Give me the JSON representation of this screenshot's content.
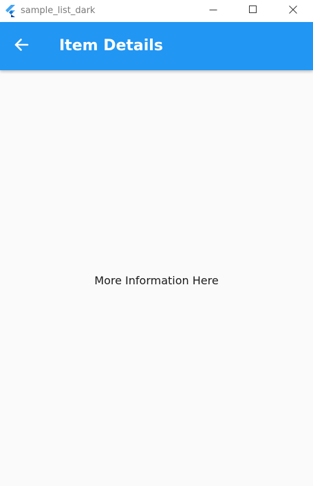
{
  "window": {
    "title": "sample_list_dark",
    "icon": "flutter-logo-icon",
    "controls": [
      "minimize-icon",
      "maximize-icon",
      "close-icon"
    ]
  },
  "appbar": {
    "back_icon": "arrow-left-icon",
    "title": "Item Details",
    "color": "#2196f3"
  },
  "body": {
    "text": "More Information Here",
    "background": "#fafafa"
  }
}
